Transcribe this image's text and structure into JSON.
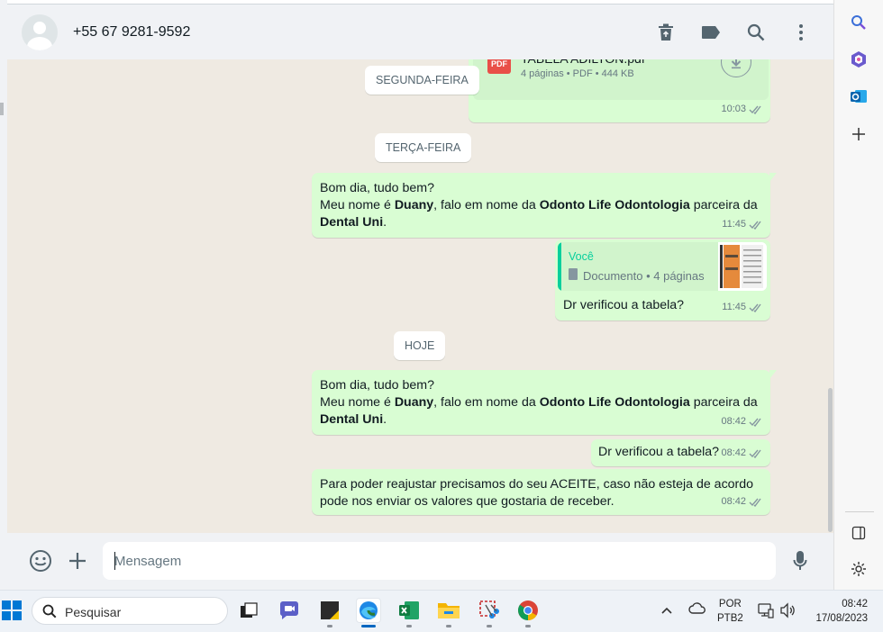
{
  "header": {
    "contact_name": "+55 67 9281-9592",
    "icons": [
      "delete-icon",
      "label-icon",
      "search-icon",
      "menu-icon"
    ]
  },
  "attachment": {
    "file_name": "TABELA ADILTON.pdf",
    "badge": "PDF",
    "info": "4 páginas • PDF • 444 KB",
    "time": "10:03"
  },
  "dates": {
    "monday": "SEGUNDA-FEIRA",
    "tuesday": "TERÇA-FEIRA",
    "today": "HOJE"
  },
  "messages": {
    "intro_1": {
      "line1": "Bom dia, tudo bem?",
      "line2_pre": "Meu nome é ",
      "line2_name": "Duany",
      "line2_mid": ", falo em nome da ",
      "line2_company": "Odonto Life Odontologia",
      "line2_post": " parceira da",
      "line3_bold": "Dental Uni",
      "line3_post": ".",
      "time": "11:45"
    },
    "reply_1": {
      "quote_author": "Você",
      "quote_text": "Documento • 4 páginas",
      "text": "Dr verificou a tabela?",
      "time": "11:45"
    },
    "intro_2": {
      "line1": "Bom dia, tudo bem?",
      "line2_pre": "Meu nome é ",
      "line2_name": "Duany",
      "line2_mid": ", falo em nome da ",
      "line2_company": "Odonto Life Odontologia",
      "line2_post": " parceira da",
      "line3_bold": "Dental Uni",
      "line3_post": ".",
      "time": "08:42"
    },
    "reply_2": {
      "text": "Dr verificou a tabela?",
      "time": "08:42"
    },
    "last": {
      "line1": "Para poder reajustar precisamos do seu ACEITE, caso não esteja de acordo",
      "line2": "pode nos enviar os valores que gostaria de receber.",
      "time": "08:42"
    }
  },
  "compose": {
    "placeholder": "Mensagem",
    "value": ""
  },
  "taskbar": {
    "search_label": "Pesquisar",
    "lang_1": "POR",
    "lang_2": "PTB2",
    "time": "08:42",
    "date": "17/08/2023"
  },
  "colors": {
    "bubble_out": "#d9fdd3",
    "chat_bg": "#efeae2",
    "header_bg": "#f0f2f5",
    "accent": "#06cf9c",
    "tick_color": "#8696a0"
  }
}
